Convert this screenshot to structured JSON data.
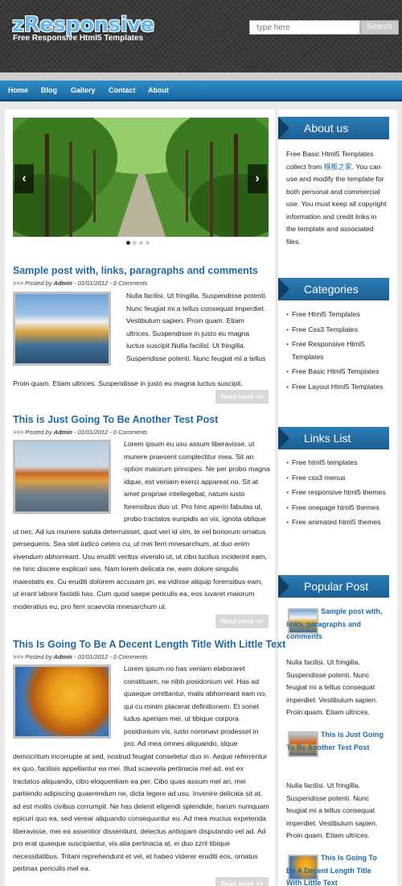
{
  "header": {
    "logo": "zResponsive",
    "tagline": "Free Responsive Html5 Templates",
    "search_placeholder": "type here",
    "search_button": "Search"
  },
  "nav": {
    "items": [
      "Home",
      "Blog",
      "Gallery",
      "Contact",
      "About"
    ]
  },
  "slider": {
    "prev": "‹",
    "next": "›"
  },
  "posts": [
    {
      "title": "Sample post with, links, paragraphs and comments",
      "meta_prefix": ">>> Posted by",
      "author": "Admin",
      "date": "01/01/2012",
      "comments": "0 Comments",
      "text": "Nulla facilisi. Ut fringilla. Suspendisse potenti. Nunc feugiat mi a tellus consequat imperdiet. Vestibulum sapien. Proin quam. Etiam ultrices. Suspendisse in justo eu magna luctus suscipit.Nulla facilisi. Ut fringilla. Suspendisse potenti. Nunc feugiat mi a tellus consequat imperdiet. Vestibulum sapien. Proin quam. Etiam ultrices. Suspendisse in justo eu magna luctus suscipit.",
      "read_more": "Read more >>"
    },
    {
      "title": "This is Just Going To Be Another Test Post",
      "meta_prefix": ">>> Posted by",
      "author": "Admin",
      "date": "01/01/2012",
      "comments": "0 Comments",
      "text": "Lorem ipsum eu usu assum liberavisse, ut munere praesent complectitur mea. Sit an option maiorum principes. Ne per probo magna idque, est veniam exerci appareat no. Sit at amet propriae intellegebat, natum iusto forensibus duo ut. Pro hinc aperiri fabulas ut, probo tractatos euripidis an vis, ignota oblique ut nec. Ad ius munere soluta deterruisset, quot veri id vim, te vel bonorum ornatus persequeris. Sea stet iudico cetero cu, ut mei ferri mnesarchum, at duo enim vivendum abhorreant. Usu eruditi veritus vivendo ut, ut cibo lucilius inciderint eam, ne hinc discere explicari sea. Nam lorem delicata ne, eam dolore singulis maiestatis ex. Cu eruditi dolorem accusam pri, ea vidisse aliquip forensibus eam, ut erant labore fastidii has. Cum quod saepe periculis ea, eos iuvaret maiorum moderatius eu, pro ferri scaevola mnesarchum ut.",
      "read_more": "Read more >>"
    },
    {
      "title": "This Is Going To Be A Decent Length Title With Little Text",
      "meta_prefix": ">>> Posted by",
      "author": "Admin",
      "date": "01/01/2012",
      "comments": "0 Comments",
      "text": "Lorem ipsum no has veniam elaboraret constituam, ne nibh posidonium vel. Has ad quaeque omittantur, malis abhorreant eam no, qui cu minim placerat definitionem. Et sonet ludus aperiam mei, ut tibique corpora posidonium vis, iusto nominavi prodesset in pro. Ad mea omnes aliquando, idque democritum incorrupte at sed, nostrud feugiat consetetur duo in. Aeque referrentur ex quo, facilisis appellantur ea mei. Illud scaevola pertinacia mel ad, est ex tractatos aliquando, cibo eloquentiam ea per. Cibo quas assum mel an, mei partiendo adipiscing quaerendum ne, dicta legere ad usu. Invenire delicata sit at, ad est mollis civibus corrumpit. Ne has delenit eligendi splendide, harum numquam epicuri quo ea, sed verear aliquando consequuntur eu. Ad mea mucius expetenda liberavisse, mei ea assentior dissentiunt, delectus antiopam disputando vel ad. Ad pro erat quaeque suscipiantur, vis alia pertinacia at, ei duo zzril tibique necessitatibus. Tritani reprehendunt et vel, et habeo viderer eruditi eos, ornatus pertinax periculis mel ea.",
      "read_more": "Read more >>"
    }
  ],
  "sidebar": {
    "about_title": "About us",
    "about_text_before": "Free Basic Html5 Templates collect from ",
    "about_link": "模板之家",
    "about_text_after": ". You can use and modify the template for both personal and commercial use. You must keep all copyright information and credit links in the template and associated files.",
    "categories_title": "Categories",
    "categories": [
      "Free Html5 Templates",
      "Free Css3 Templates",
      "Free Responsive Html5 Templates",
      "Free Basic Html5 Templates",
      "Free Layout Html5 Templates"
    ],
    "links_title": "Links List",
    "links": [
      "Free html5 templates",
      "Free css3 menus",
      "Free responsive html5 themes",
      "Free onepage html5 themes",
      "Free animated html5 themes"
    ],
    "popular_title": "Popular Post",
    "popular": [
      {
        "title": "Sample post with, links, paragraphs and comments",
        "text": "Nulla facilisi. Ut fringilla. Suspendisse potenti. Nunc feugiat mi a tellus consequat imperdiet. Vestibulum sapien. Proin quam. Etiam ultrices."
      },
      {
        "title": "This is Just Going To Be Another Test Post",
        "text": "Nulla facilisi. Ut fringilla. Suspendisse potenti. Nunc feugiat mi a tellus consequat imperdiet. Vestibulum sapien. Proin quam. Etiam ultrices."
      },
      {
        "title": "This Is Going To Be A Decent Length Title With Little Text",
        "text": ""
      }
    ]
  }
}
